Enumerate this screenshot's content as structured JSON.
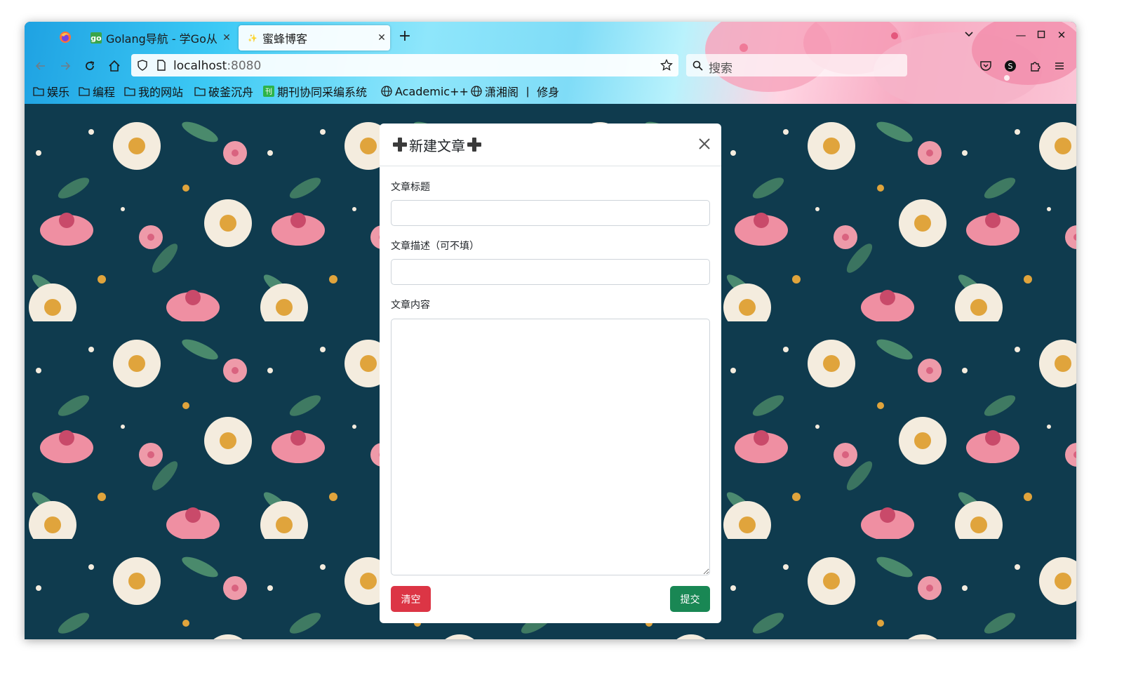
{
  "browser": {
    "tabs": [
      {
        "title": "Golang导航 - 学Go从",
        "active": false,
        "favicon": "go-icon"
      },
      {
        "title": "蜜蜂博客",
        "active": true,
        "favicon": "sparkle-icon"
      }
    ],
    "url": {
      "host": "localhost",
      "port": ":8080"
    },
    "search_placeholder": "搜索",
    "bookmarks": [
      {
        "label": "娱乐",
        "icon": "folder-icon"
      },
      {
        "label": "编程",
        "icon": "folder-icon"
      },
      {
        "label": "我的网站",
        "icon": "folder-icon"
      },
      {
        "label": "破釜沉舟",
        "icon": "folder-icon"
      },
      {
        "label": "期刊协同采编系统",
        "icon": "journal-icon"
      },
      {
        "label": "Academic++",
        "icon": "globe-icon"
      },
      {
        "label": "潇湘阁 丨 修身",
        "icon": "globe-icon"
      }
    ]
  },
  "modal": {
    "title": "新建文章",
    "fields": {
      "title_label": "文章标题",
      "title_value": "",
      "desc_label": "文章描述（可不填）",
      "desc_value": "",
      "content_label": "文章内容",
      "content_value": ""
    },
    "buttons": {
      "clear": "清空",
      "submit": "提交"
    }
  },
  "colors": {
    "danger": "#dc3545",
    "success": "#198754",
    "background": "#0f3b4e"
  }
}
